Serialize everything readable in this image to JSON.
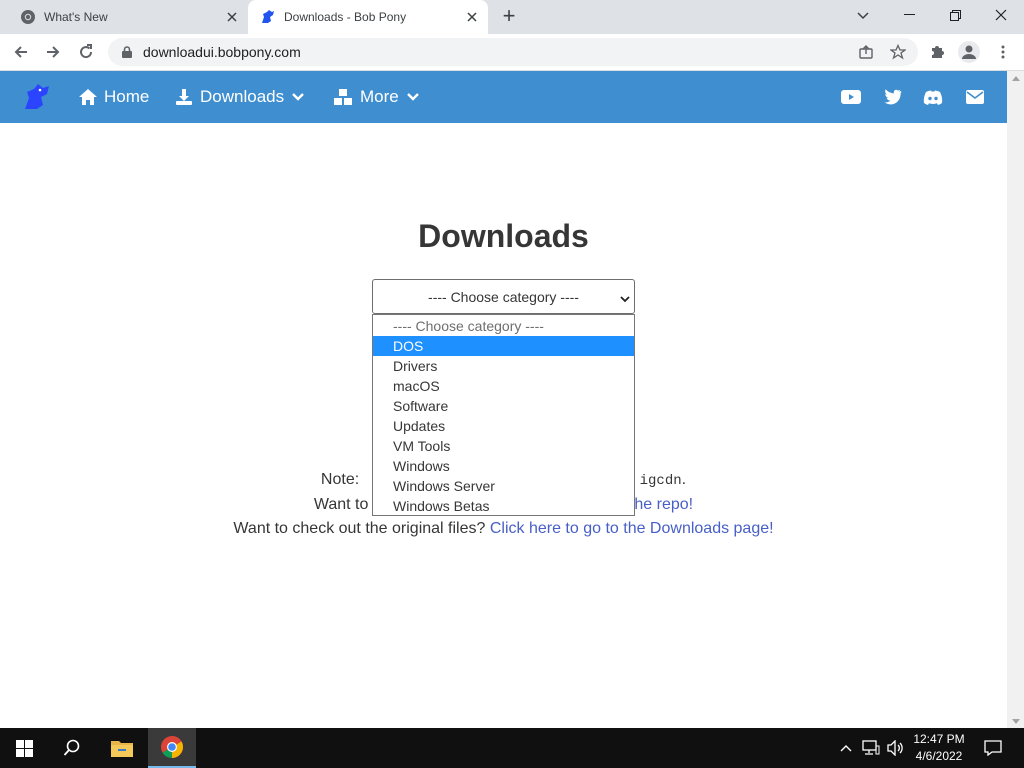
{
  "browser": {
    "tabs": [
      {
        "title": "What's New",
        "active": false,
        "favicon": "chrome-icon"
      },
      {
        "title": "Downloads - Bob Pony",
        "active": true,
        "favicon": "bobpony-logo-icon"
      }
    ],
    "new_tab_label": "+",
    "address": "downloadui.bobpony.com"
  },
  "site": {
    "nav": {
      "home_label": "Home",
      "downloads_label": "Downloads",
      "more_label": "More",
      "social_icons": [
        "youtube-icon",
        "twitter-icon",
        "discord-icon",
        "email-icon"
      ]
    },
    "heading": "Downloads",
    "category_select": {
      "selected": "---- Choose category ----",
      "options": [
        "---- Choose category ----",
        "DOS",
        "Drivers",
        "macOS",
        "Software",
        "Updates",
        "VM Tools",
        "Windows",
        "Windows Server",
        "Windows Betas"
      ],
      "highlighted": "DOS"
    },
    "notes": {
      "line1_prefix": "Note: ",
      "line1_code": "igcdn",
      "line1_suffix": ".",
      "line2_prefix": "Want to",
      "line2_link": "he repo!",
      "line3_prefix": "Want to check out the original files? ",
      "line3_link": "Click here to go to the Downloads page!"
    }
  },
  "taskbar": {
    "time": "12:47 PM",
    "date": "4/6/2022"
  },
  "colors": {
    "navbar": "#3e8ed0",
    "link": "#485fc7",
    "option_highlight": "#1e90ff",
    "taskbar": "#101010"
  }
}
